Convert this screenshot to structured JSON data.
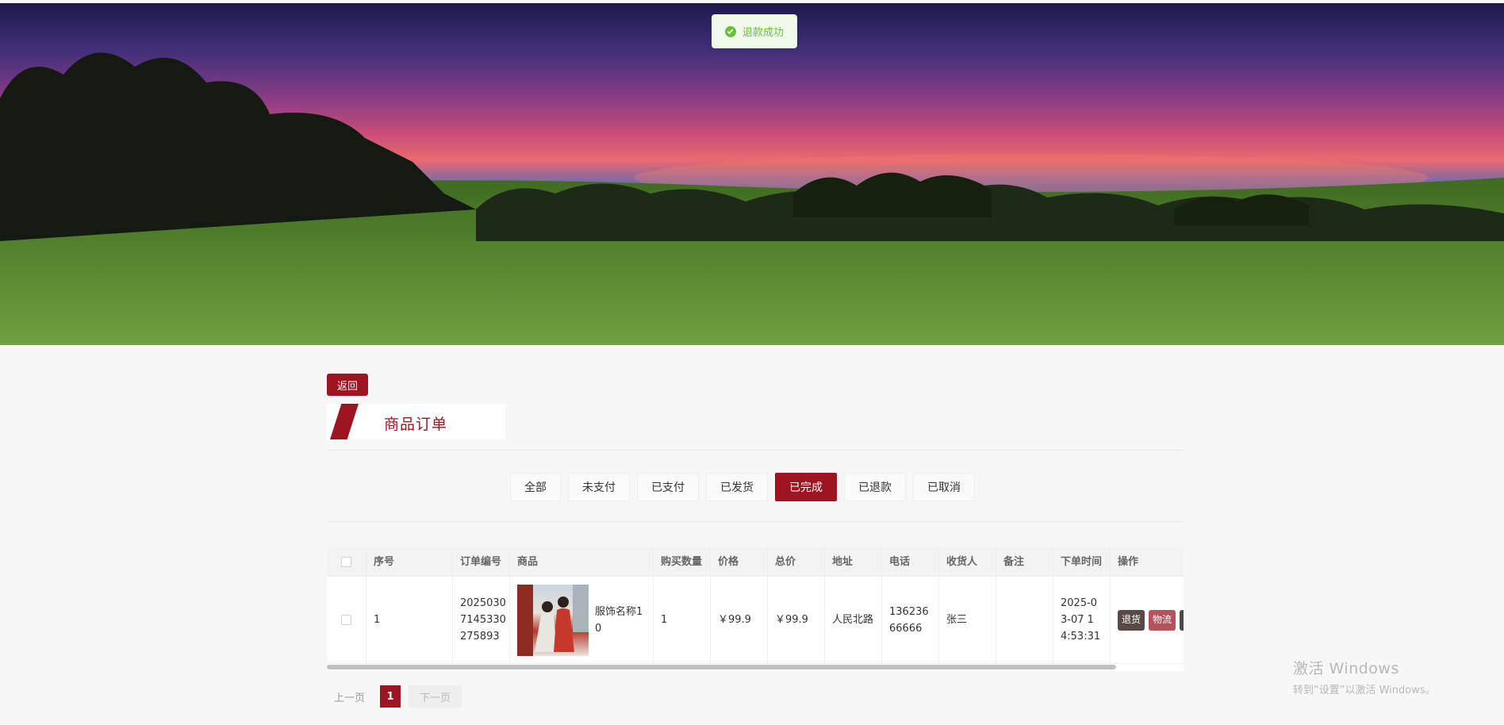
{
  "toast": {
    "message": "退款成功",
    "icon": "success-check-icon",
    "color": "#67c23a"
  },
  "back_label": "返回",
  "page_title": "商品订单",
  "accent_color": "#9e1421",
  "tabs": [
    {
      "label": "全部",
      "active": false
    },
    {
      "label": "未支付",
      "active": false
    },
    {
      "label": "已支付",
      "active": false
    },
    {
      "label": "已发货",
      "active": false
    },
    {
      "label": "已完成",
      "active": true
    },
    {
      "label": "已退款",
      "active": false
    },
    {
      "label": "已取消",
      "active": false
    }
  ],
  "table": {
    "headers": [
      "序号",
      "订单编号",
      "商品",
      "购买数量",
      "价格",
      "总价",
      "地址",
      "电话",
      "收货人",
      "备注",
      "下单时间",
      "操作"
    ],
    "rows": [
      {
        "index": "1",
        "order_no": "20250307145330275893",
        "order_no_display": "2025030 7145330 275893",
        "product_name": "服饰名称10",
        "quantity": "1",
        "price": "￥99.9",
        "total": "￥99.9",
        "address": "人民北路",
        "phone": "13623666666",
        "receiver": "张三",
        "remark": "",
        "time": "2025-03-07 14:53:31",
        "actions": [
          "退货",
          "物流"
        ]
      }
    ]
  },
  "pagination": {
    "prev": "上一页",
    "current": "1",
    "next": "下一页"
  },
  "watermark": {
    "title": "激活 Windows",
    "subtitle": "转到“设置”以激活 Windows。"
  }
}
